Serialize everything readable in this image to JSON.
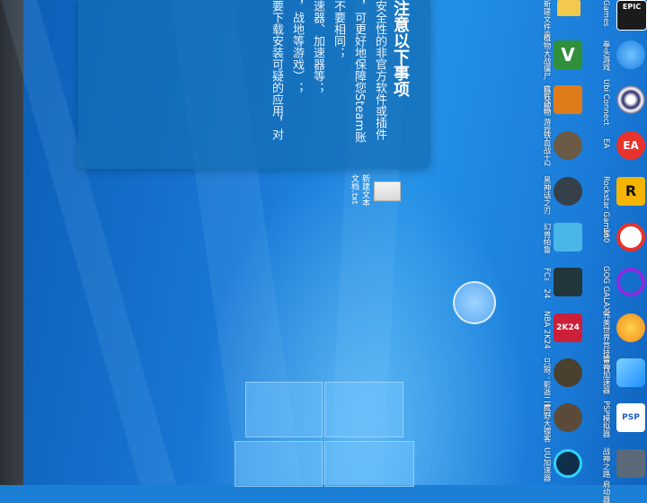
{
  "notice": {
    "title": "注意以下事项",
    "lines": [
      "安全性的非官方软件或插件",
      "，可更好地保障您Steam账",
      "不要相同；",
      "速器、加速器等；",
      "，战地等游戏）；",
      "要下载安装可疑的应用，对"
    ]
  },
  "desktop_file": {
    "label": "新建文本文档.txt"
  },
  "icons_right": [
    {
      "name": "Games",
      "label": "Games",
      "icon": "epic-icon",
      "color": "#1b1b1b"
    },
    {
      "name": "拳头游戏",
      "label": "拳头游戏",
      "icon": "battlenet-icon",
      "color": "#1f7fe0"
    },
    {
      "name": "Ubi Connect",
      "label": "Ubi Connect",
      "icon": "ubisoft-icon",
      "color": "#ffffff"
    },
    {
      "name": "EA",
      "label": "EA",
      "icon": "ea-icon",
      "color": "#e8322d"
    },
    {
      "name": "Rockstar Games",
      "label": "Rockstar Games",
      "icon": "rockstar-icon",
      "color": "#f5b400"
    },
    {
      "name": "360",
      "label": "360",
      "icon": "360-icon",
      "color": "#ffffff"
    },
    {
      "name": "GOG GALAXY",
      "label": "GOG GALAXY",
      "icon": "gog-icon",
      "color": "#8a2be2"
    },
    {
      "name": "完美世界竞技平台",
      "label": "完美世界竞技平台",
      "icon": "perfect-world-icon",
      "color": "#f08a1c"
    },
    {
      "name": "雷神加速器",
      "label": "雷神加速器",
      "icon": "leishen-icon",
      "color": "#1e90ff"
    },
    {
      "name": "PSP模拟器",
      "label": "PSP模拟器",
      "icon": "psp-icon",
      "color": "#ffffff"
    },
    {
      "name": "战神之路",
      "label": "战神之路 启动器",
      "icon": "game-icon",
      "color": "#5a6a78"
    }
  ],
  "icons_left": [
    {
      "name": "植物大战僵尸",
      "label": "植物大战僵尸（杂交版）",
      "icon": "v-icon",
      "color": "#2f8f3a"
    },
    {
      "name": "疯狂动物",
      "label": "疯狂动物 游戏",
      "icon": "cartoon-icon",
      "color": "#e07b1a"
    },
    {
      "name": "铁血战士",
      "label": "铁血战士2",
      "icon": "soldier-icon",
      "color": "#6b5a45"
    },
    {
      "name": "黑神话之刃",
      "label": "黑神话之刃",
      "icon": "dark-icon",
      "color": "#35404a"
    },
    {
      "name": "幻兽帕鲁",
      "label": "幻兽帕鲁",
      "icon": "palworld-icon",
      "color": "#49b6e8"
    },
    {
      "name": "FC 24",
      "label": "FC™ 24",
      "icon": "fc24-icon",
      "color": "#20363a"
    },
    {
      "name": "NBA 2K24",
      "label": "NBA 2K24",
      "icon": "nba2k-icon",
      "color": "#cc1f3a"
    },
    {
      "name": "只狼",
      "label": "只狼：影逝二度",
      "icon": "sekiro-icon",
      "color": "#4a4030"
    },
    {
      "name": "荒野大镖客",
      "label": "荒野大镖客",
      "icon": "rdr-icon",
      "color": "#5b4a3a"
    },
    {
      "name": "UU加速器",
      "label": "UU加速器",
      "icon": "uu-icon",
      "color": "#0f2f4a"
    }
  ],
  "folder": {
    "label": "新建文件夹"
  }
}
